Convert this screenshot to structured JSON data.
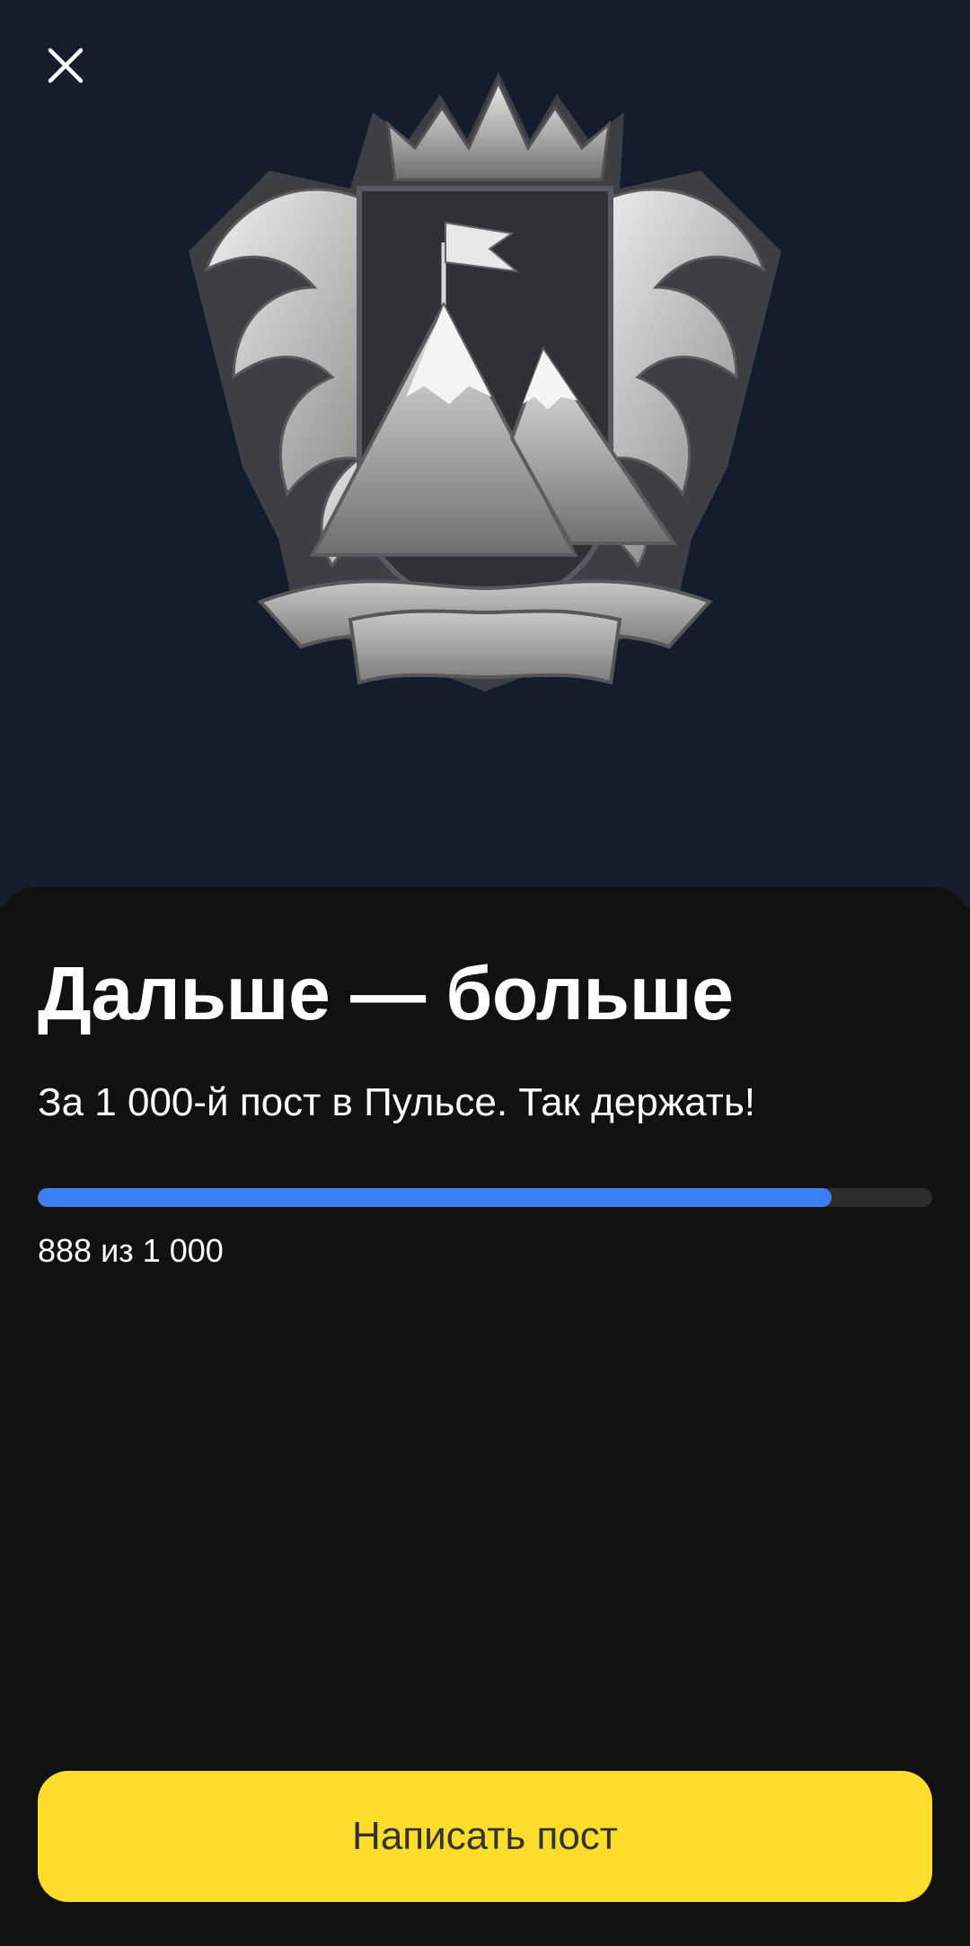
{
  "colors": {
    "hero_background": "#141c2e",
    "sheet_background": "#111111",
    "progress_fill": "#3d7ff2",
    "progress_track": "#2e2e2e",
    "button_background": "#ffdd2d",
    "button_text": "#333333"
  },
  "header": {
    "close_icon": "close-icon"
  },
  "badge": {
    "icon": "mountain-crest-badge"
  },
  "achievement": {
    "title": "Дальше — больше",
    "description": "За 1 000-й пост в Пульсе. Так держать!",
    "progress": {
      "current": 888,
      "target": 1000,
      "label": "888 из 1 000"
    }
  },
  "actions": {
    "primary_label": "Написать пост"
  }
}
